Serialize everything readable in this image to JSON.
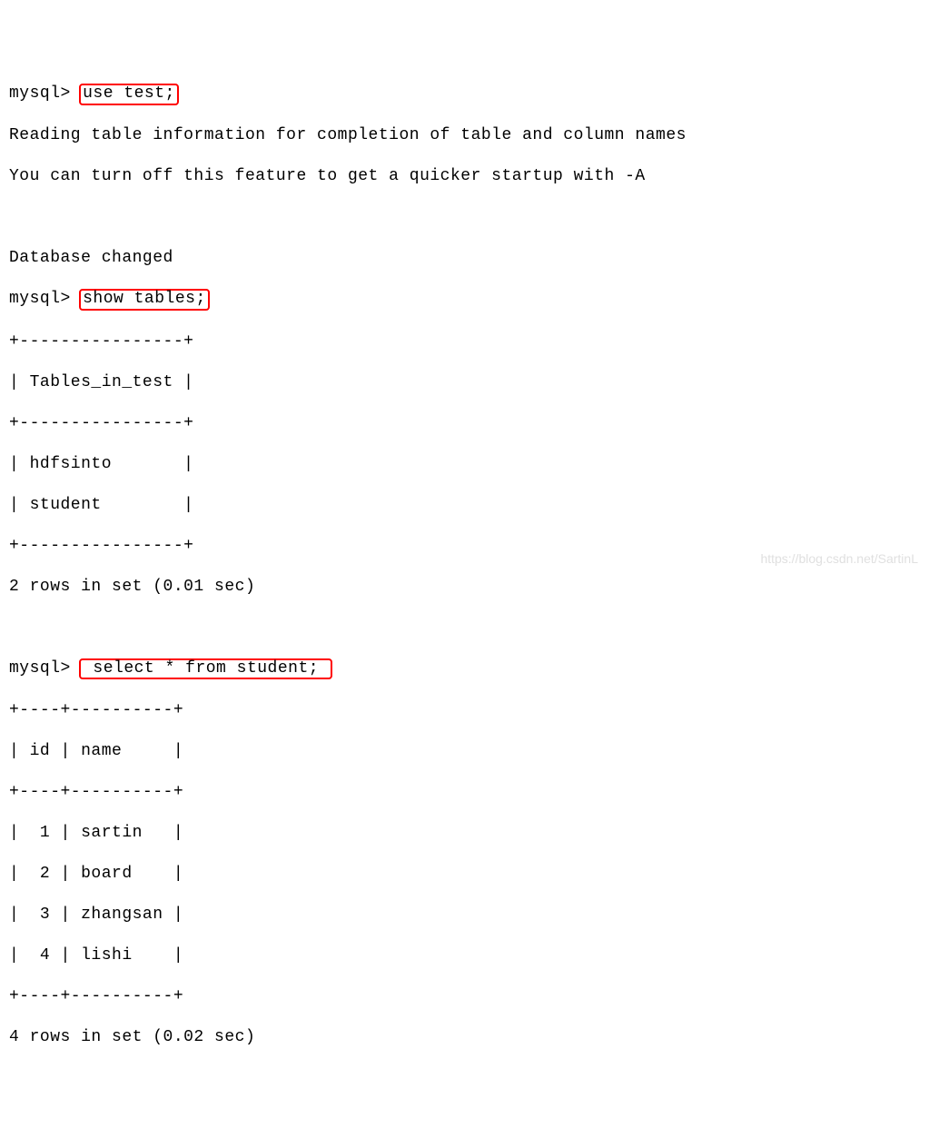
{
  "prompt": "mysql> ",
  "cmd1": "use test;",
  "response1_line1": "Reading table information for completion of table and column names",
  "response1_line2": "You can turn off this feature to get a quicker startup with -A",
  "response1_line3": "Database changed",
  "cmd2": "show tables;",
  "tables_border": "+----------------+",
  "tables_header": "| Tables_in_test |",
  "tables_row1": "| hdfsinto       |",
  "tables_row2": "| student        |",
  "tables_footer": "2 rows in set (0.01 sec)",
  "cmd3": " select * from student; ",
  "student_border": "+----+----------+",
  "student_header": "| id | name     |",
  "student_row1": "|  1 | sartin   |",
  "student_row2": "|  2 | board    |",
  "student_row3": "|  3 | zhangsan |",
  "student_row4": "|  4 | lishi    |",
  "student_footer": "4 rows in set (0.02 sec)",
  "watermark": "https://blog.csdn.net/SartinL"
}
